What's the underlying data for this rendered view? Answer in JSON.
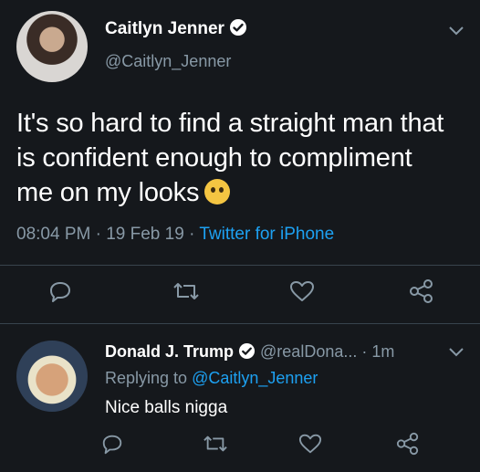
{
  "tweet": {
    "author_name": "Caitlyn Jenner",
    "author_handle": "@Caitlyn_Jenner",
    "text": "It's so hard to find a straight man that is confident enough to compliment me on my looks",
    "emoji": "rolling-eyes-emoji",
    "time": "08:04 PM",
    "dot1": "·",
    "date": "19 Feb 19",
    "dot2": "·",
    "source": "Twitter for iPhone"
  },
  "reply": {
    "author_name": "Donald J. Trump",
    "author_handle": "@realDona...",
    "dot": "·",
    "age": "1m",
    "replying_prefix": "Replying to",
    "replying_to": "@Caitlyn_Jenner",
    "text": "Nice balls nigga"
  },
  "icons": {
    "reply": "reply-icon",
    "retweet": "retweet-icon",
    "like": "heart-icon",
    "share": "share-icon",
    "verified": "verified-badge-icon",
    "menu": "chevron-down-icon"
  },
  "colors": {
    "background": "#15181c",
    "text": "#ffffff",
    "secondary": "#8899a6",
    "link": "#1da1f2",
    "divider": "#38444d"
  }
}
